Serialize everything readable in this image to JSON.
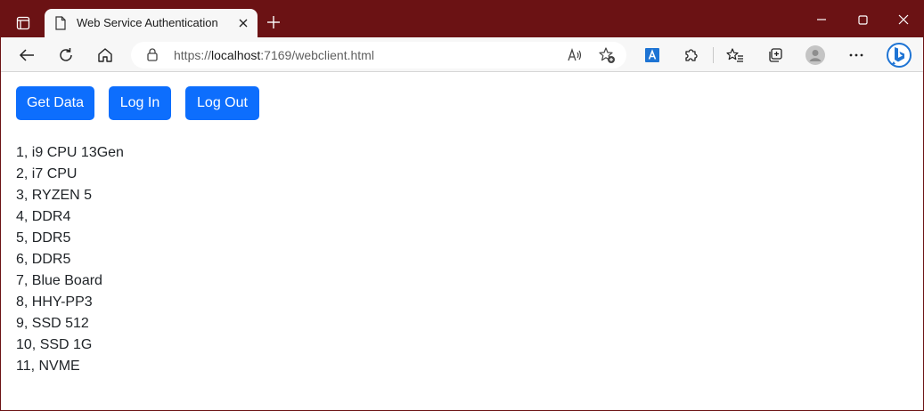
{
  "browser": {
    "tab_title": "Web Service Authentication",
    "url_scheme": "https://",
    "url_host": "localhost",
    "url_rest": ":7169/webclient.html"
  },
  "page": {
    "buttons": {
      "get_data": "Get Data",
      "log_in": "Log In",
      "log_out": "Log Out"
    },
    "items": [
      "1, i9 CPU 13Gen",
      "2, i7 CPU",
      "3, RYZEN 5",
      "4, DDR4",
      "5, DDR5",
      "6, DDR5",
      "7, Blue Board",
      "8, HHY-PP3",
      "9, SSD 512",
      "10, SSD 1G",
      "11, NVME"
    ]
  },
  "colors": {
    "titlebar": "#6b1214",
    "primary_button": "#0d6efd",
    "bing_blue": "#1e74d4"
  },
  "icons": [
    "tab-actions-icon",
    "page-icon",
    "close-icon",
    "plus-icon",
    "minimize-icon",
    "maximize-icon",
    "back-icon",
    "refresh-icon",
    "home-icon",
    "lock-icon",
    "read-aloud-icon",
    "favorite-add-icon",
    "translate-icon",
    "extensions-icon",
    "favorites-icon",
    "collections-icon",
    "profile-icon",
    "more-icon",
    "copilot-icon"
  ]
}
